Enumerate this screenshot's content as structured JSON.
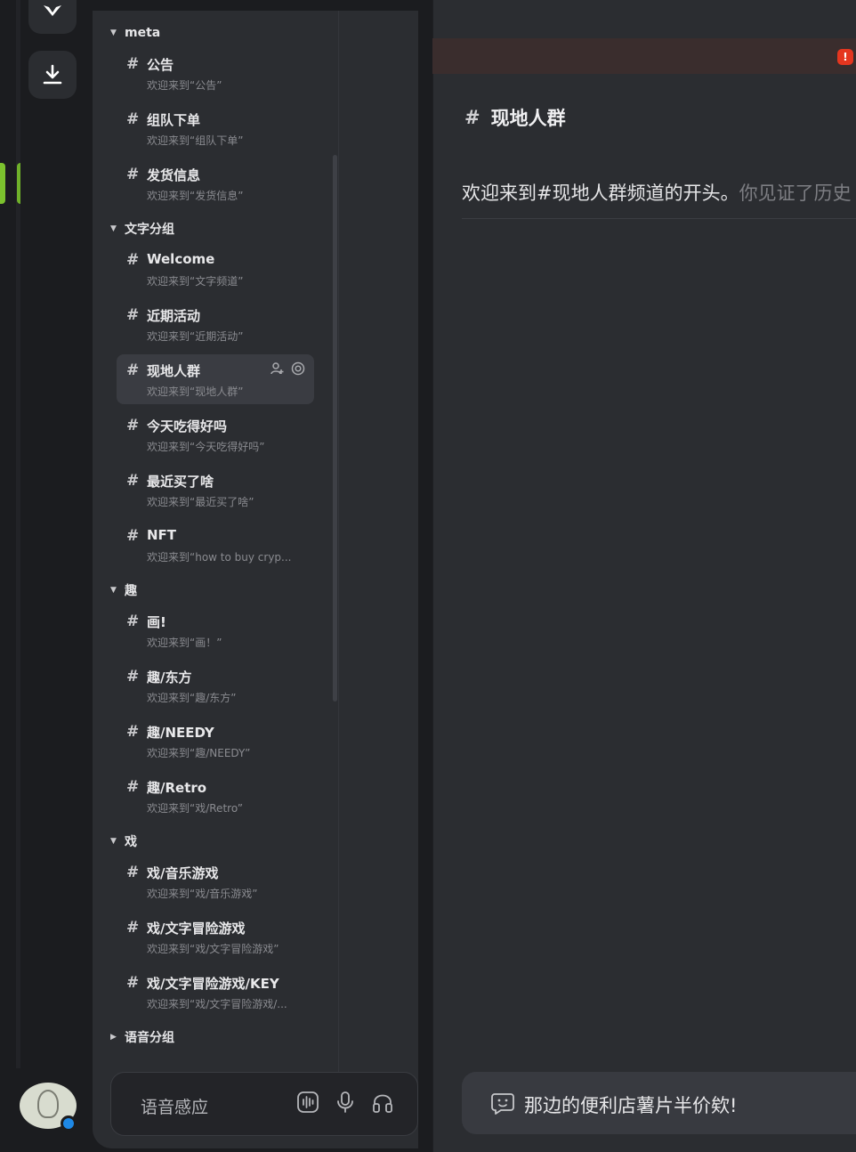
{
  "channel_list": {
    "categories": [
      {
        "name": "meta",
        "channels": [
          {
            "name": "公告",
            "desc": "欢迎来到“公告”"
          },
          {
            "name": "组队下单",
            "desc": "欢迎来到“组队下单”"
          },
          {
            "name": "发货信息",
            "desc": "欢迎来到“发货信息”"
          }
        ]
      },
      {
        "name": "文字分组",
        "channels": [
          {
            "name": "Welcome",
            "desc": "欢迎来到“文字频道”"
          },
          {
            "name": "近期活动",
            "desc": "欢迎来到“近期活动”"
          },
          {
            "name": "现地人群",
            "desc": "欢迎来到“现地人群”"
          },
          {
            "name": "今天吃得好吗",
            "desc": "欢迎来到“今天吃得好吗”"
          },
          {
            "name": "最近买了啥",
            "desc": "欢迎来到“最近买了啥”"
          },
          {
            "name": "NFT",
            "desc": "欢迎来到“how to buy cryp..."
          }
        ]
      },
      {
        "name": "趣",
        "channels": [
          {
            "name": "画!",
            "desc": "欢迎来到“画！”"
          },
          {
            "name": "趣/东方",
            "desc": "欢迎来到“趣/东方”"
          },
          {
            "name": "趣/NEEDY",
            "desc": "欢迎来到“趣/NEEDY”"
          },
          {
            "name": "趣/Retro",
            "desc": "欢迎来到“戏/Retro”"
          }
        ]
      },
      {
        "name": "戏",
        "channels": [
          {
            "name": "戏/音乐游戏",
            "desc": "欢迎来到“戏/音乐游戏”"
          },
          {
            "name": "戏/文字冒险游戏",
            "desc": "欢迎来到“戏/文字冒险游戏”"
          },
          {
            "name": "戏/文字冒险游戏/KEY",
            "desc": "欢迎来到“戏/文字冒险游戏/..."
          }
        ]
      },
      {
        "name": "语音分组",
        "channels": []
      }
    ]
  },
  "voice_bar": {
    "label": "语音感应"
  },
  "main": {
    "channel_title": "现地人群",
    "welcome_text": "欢迎来到#现地人群频道的开头。",
    "welcome_muted": "你见证了历史",
    "alert_badge": "!",
    "composer_placeholder": "那边的便利店薯片半价欸!"
  },
  "icons": {
    "download": "download-icon",
    "hash": "hash-icon",
    "invite": "add-member-icon",
    "settings": "settings-icon",
    "waveform": "voice-waveform-icon",
    "mic": "microphone-icon",
    "headset": "headphones-icon",
    "emoji": "emoji-icon"
  },
  "colors": {
    "accent_green": "#7cc22e",
    "alert_red": "#e5361f",
    "status_blue": "#1e88e5"
  }
}
